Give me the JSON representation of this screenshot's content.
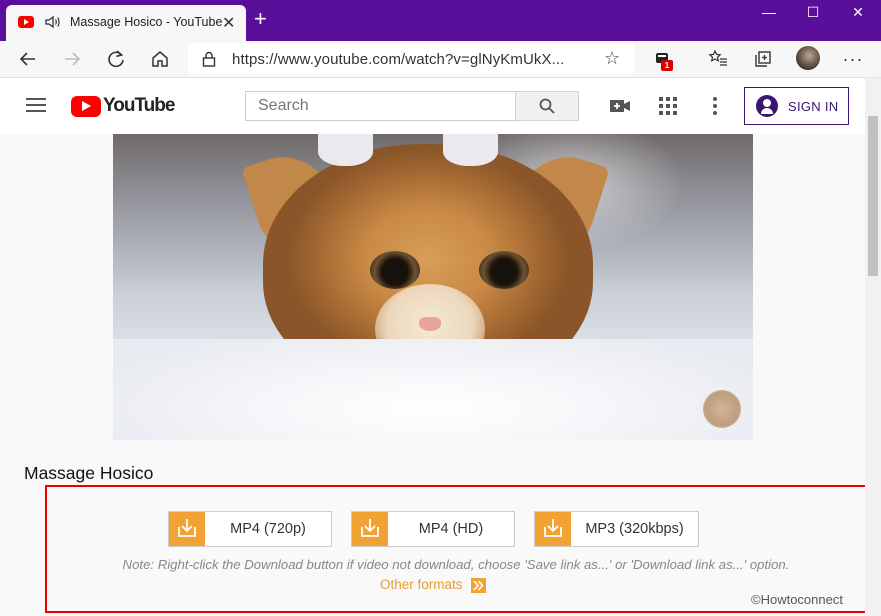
{
  "browser": {
    "tab_title": "Massage Hosico - YouTube",
    "tab_close": "✕",
    "new_tab": "+",
    "window_controls": [
      "—",
      "☐",
      "✕"
    ],
    "url": "https://www.youtube.com/watch?v=glNyKmUkX...",
    "extension_badge": "1",
    "accent_color": "#5a0f9a"
  },
  "youtube": {
    "logo_text": "YouTube",
    "search_placeholder": "Search",
    "sign_in": "SIGN IN"
  },
  "video": {
    "title": "Massage Hosico"
  },
  "download_panel": {
    "buttons": [
      {
        "label": "MP4 (720p)"
      },
      {
        "label": "MP4 (HD)"
      },
      {
        "label": "MP3 (320kbps)"
      }
    ],
    "note": "Note: Right-click the Download button if video not download, choose 'Save link as...' or 'Download link as...' option.",
    "other_formats": "Other formats",
    "border_color": "#e60000",
    "accent_color": "#f2a232"
  },
  "credit": "©Howtoconnect"
}
